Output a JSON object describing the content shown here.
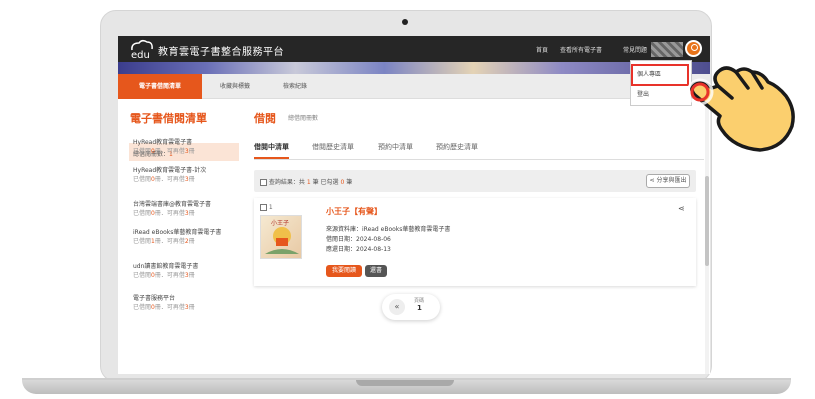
{
  "header": {
    "site_title": "教育雲電子書整合服務平台",
    "nav": [
      "首頁",
      "查看所有電子書",
      "常見問題"
    ],
    "user_menu": [
      "個人專區",
      "登出"
    ]
  },
  "tabs": [
    "電子書借閱清單",
    "收藏與標籤",
    "檢索紀錄"
  ],
  "sidebar": {
    "title": "電子書借閱清單",
    "count_label": "總借閱冊數：",
    "count_value": "1",
    "items": [
      {
        "name": "HyRead教育雲電子書",
        "borrowed": "0",
        "remaining": "3"
      },
      {
        "name": "HyRead教育雲電子書-計次",
        "borrowed": "0",
        "remaining": "3"
      },
      {
        "name": "台灣雲端書庫@教育雲電子書",
        "borrowed": "0",
        "remaining": "3"
      },
      {
        "name": "iRead eBooks華藝教育雲電子書",
        "borrowed": "1",
        "remaining": "2"
      },
      {
        "name": "udn讀書館教育雲電子書",
        "borrowed": "0",
        "remaining": "3"
      },
      {
        "name": "電子書服務平台",
        "borrowed": "0",
        "remaining": "3"
      }
    ],
    "sub_prefix": "已借閱",
    "sub_mid": "冊．可再借",
    "sub_suffix": "冊"
  },
  "main": {
    "title": "借閱",
    "subtitle": "總借閱冊數",
    "subtabs": [
      "借閱中清單",
      "借閱歷史清單",
      "預約中清單",
      "預約歷史清單"
    ],
    "query_prefix": "查詢結果：共",
    "query_total": "1",
    "query_mid": "筆 已勾選",
    "query_checked": "0",
    "query_suffix": "筆",
    "share_label": "分享與匯出"
  },
  "book": {
    "index": "1",
    "title": "小王子【有聲】",
    "source": "來源資料庫：iRead eBooks華藝教育雲電子書",
    "borrow_date": "借閱日期：2024-08-06",
    "return_date": "應還日期：2024-08-13",
    "read_label": "我要閱讀",
    "return_label": "還書",
    "cover_text": "小王子"
  },
  "pager": {
    "label": "頁碼",
    "page": "1",
    "prev": "«"
  }
}
